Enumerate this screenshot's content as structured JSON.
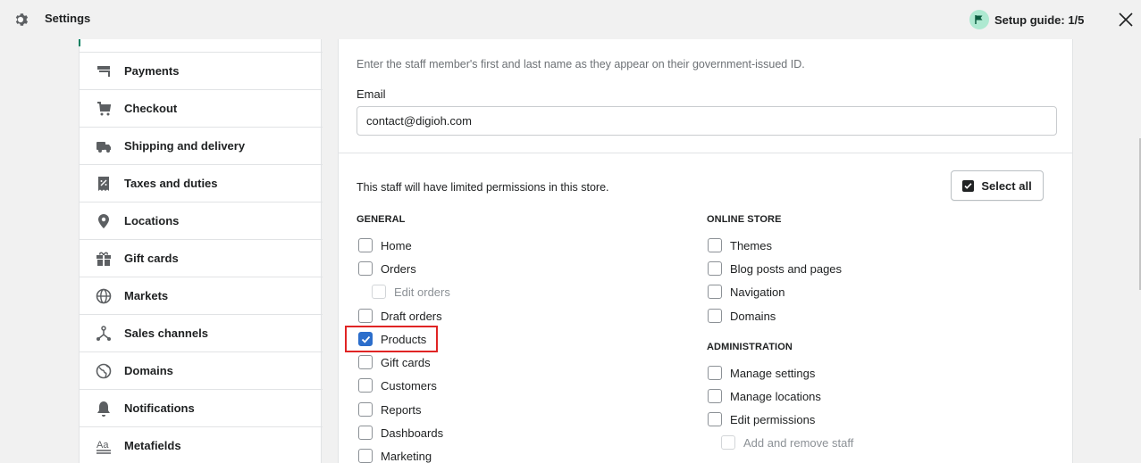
{
  "topbar": {
    "title": "Settings",
    "gear_icon": "gear-icon",
    "setup_guide": "Setup guide: 1/5",
    "flag_icon": "flag-icon",
    "close_icon": "close-icon"
  },
  "sidebar": {
    "items": [
      {
        "label": "Payments",
        "icon": "payments-icon"
      },
      {
        "label": "Checkout",
        "icon": "cart-icon"
      },
      {
        "label": "Shipping and delivery",
        "icon": "truck-icon"
      },
      {
        "label": "Taxes and duties",
        "icon": "receipt-icon"
      },
      {
        "label": "Locations",
        "icon": "location-pin-icon"
      },
      {
        "label": "Gift cards",
        "icon": "gift-icon"
      },
      {
        "label": "Markets",
        "icon": "globe-icon"
      },
      {
        "label": "Sales channels",
        "icon": "sales-channels-icon"
      },
      {
        "label": "Domains",
        "icon": "domain-globe-icon"
      },
      {
        "label": "Notifications",
        "icon": "bell-icon"
      },
      {
        "label": "Metafields",
        "icon": "metafields-icon"
      }
    ]
  },
  "form": {
    "name_hint": "Enter the staff member's first and last name as they appear on their government-issued ID.",
    "email_label": "Email",
    "email_value": "contact@digioh.com",
    "permissions_text": "This staff will have limited permissions in this store.",
    "select_all_label": "Select all"
  },
  "general": {
    "title": "GENERAL",
    "items": [
      {
        "label": "Home",
        "checked": false,
        "disabled": false
      },
      {
        "label": "Orders",
        "checked": false,
        "disabled": false
      },
      {
        "label": "Edit orders",
        "checked": false,
        "disabled": true
      },
      {
        "label": "Draft orders",
        "checked": false,
        "disabled": false
      },
      {
        "label": "Products",
        "checked": true,
        "disabled": false
      },
      {
        "label": "Gift cards",
        "checked": false,
        "disabled": false
      },
      {
        "label": "Customers",
        "checked": false,
        "disabled": false
      },
      {
        "label": "Reports",
        "checked": false,
        "disabled": false
      },
      {
        "label": "Dashboards",
        "checked": false,
        "disabled": false
      },
      {
        "label": "Marketing",
        "checked": false,
        "disabled": false
      }
    ]
  },
  "online_store": {
    "title": "ONLINE STORE",
    "items": [
      {
        "label": "Themes",
        "checked": false,
        "disabled": false
      },
      {
        "label": "Blog posts and pages",
        "checked": false,
        "disabled": false
      },
      {
        "label": "Navigation",
        "checked": false,
        "disabled": false
      },
      {
        "label": "Domains",
        "checked": false,
        "disabled": false
      }
    ]
  },
  "administration": {
    "title": "ADMINISTRATION",
    "items": [
      {
        "label": "Manage settings",
        "checked": false,
        "disabled": false
      },
      {
        "label": "Manage locations",
        "checked": false,
        "disabled": false
      },
      {
        "label": "Edit permissions",
        "checked": false,
        "disabled": false
      },
      {
        "label": "Add and remove staff",
        "checked": false,
        "disabled": true
      }
    ]
  },
  "colors": {
    "accent_checked": "#2c6ecb",
    "highlight": "#e02424",
    "brand_green": "#008060"
  }
}
